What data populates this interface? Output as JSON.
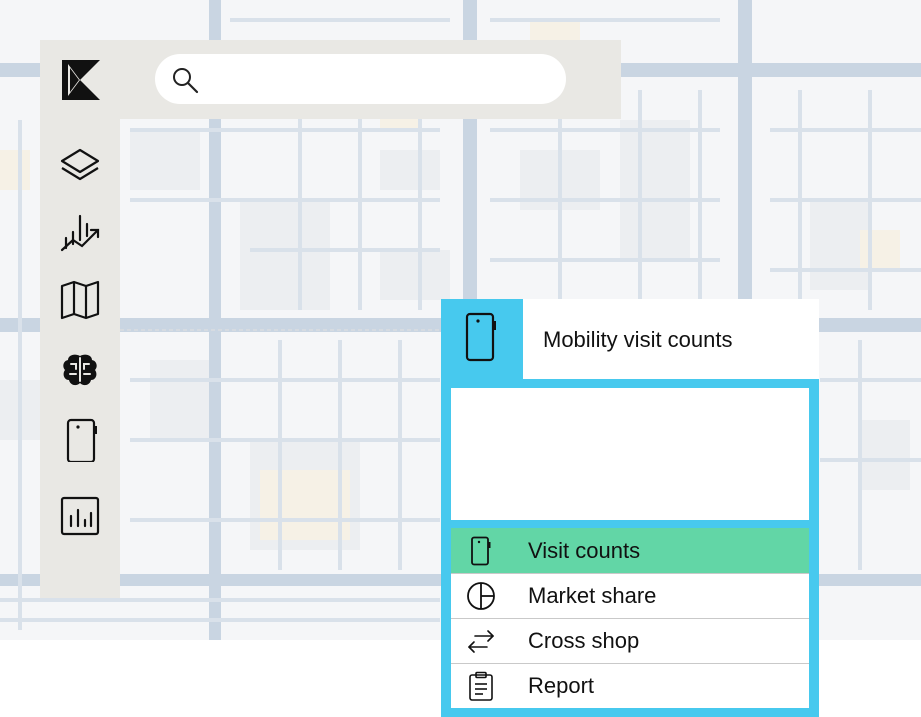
{
  "app": {
    "brand_icon": "k-logo",
    "accent_color": "#47c9ee",
    "active_color": "#62d6a6",
    "rail_color": "#e9e8e4"
  },
  "search": {
    "icon": "search-icon",
    "value": "",
    "placeholder": ""
  },
  "sidebar": {
    "items": [
      {
        "icon": "layers-icon"
      },
      {
        "icon": "trend-chart-icon"
      },
      {
        "icon": "map-icon"
      },
      {
        "icon": "brain-icon"
      },
      {
        "icon": "phone-icon"
      },
      {
        "icon": "bar-chart-icon"
      }
    ]
  },
  "panel": {
    "icon": "phone-icon",
    "title": "Mobility visit counts",
    "menu": [
      {
        "label": "Visit counts",
        "icon": "phone-icon",
        "active": true
      },
      {
        "label": "Market share",
        "icon": "pie-chart-icon",
        "active": false
      },
      {
        "label": "Cross shop",
        "icon": "swap-arrows-icon",
        "active": false
      },
      {
        "label": "Report",
        "icon": "clipboard-icon",
        "active": false
      }
    ]
  }
}
